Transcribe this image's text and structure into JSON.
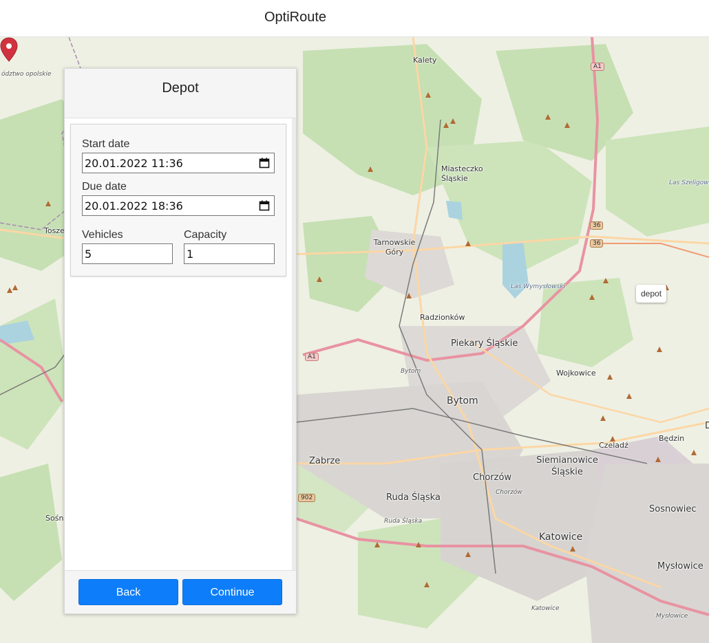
{
  "header": {
    "title": "OptiRoute"
  },
  "map": {
    "place_labels": [
      "Kalety",
      "Miasteczko Śląskie",
      "Tarnowskie Góry",
      "Radzionków",
      "Piekary Śląskie",
      "Wojkowice",
      "Bytom",
      "Zabrze",
      "Chorzów",
      "Siemianowice Śląskie",
      "Czeladź",
      "Będzin",
      "Ruda Śląska",
      "Katowice",
      "Sosnowiec",
      "Mysłowice",
      "Tosze",
      "Sośni"
    ],
    "italic_labels": [
      "Bytom",
      "Chorzów",
      "Ruda Śląska",
      "Katowice",
      "Mysłowice"
    ],
    "region_label": "ództwo opolskie",
    "water_labels": [
      "Las Wymysłowski",
      "Las Szeligowi"
    ],
    "road_shields": [
      "A1",
      "A1",
      "36",
      "36",
      "902"
    ],
    "edge_label": "D",
    "marker_label": "depot",
    "marker_color": "#d0333f"
  },
  "panel": {
    "title": "Depot",
    "start_date": {
      "label": "Start date",
      "value": "20.01.2022 11:36"
    },
    "due_date": {
      "label": "Due date",
      "value": "20.01.2022 18:36"
    },
    "vehicles": {
      "label": "Vehicles",
      "value": "5"
    },
    "capacity": {
      "label": "Capacity",
      "value": "1"
    },
    "back_label": "Back",
    "continue_label": "Continue",
    "accent_color": "#0d7dfa"
  }
}
